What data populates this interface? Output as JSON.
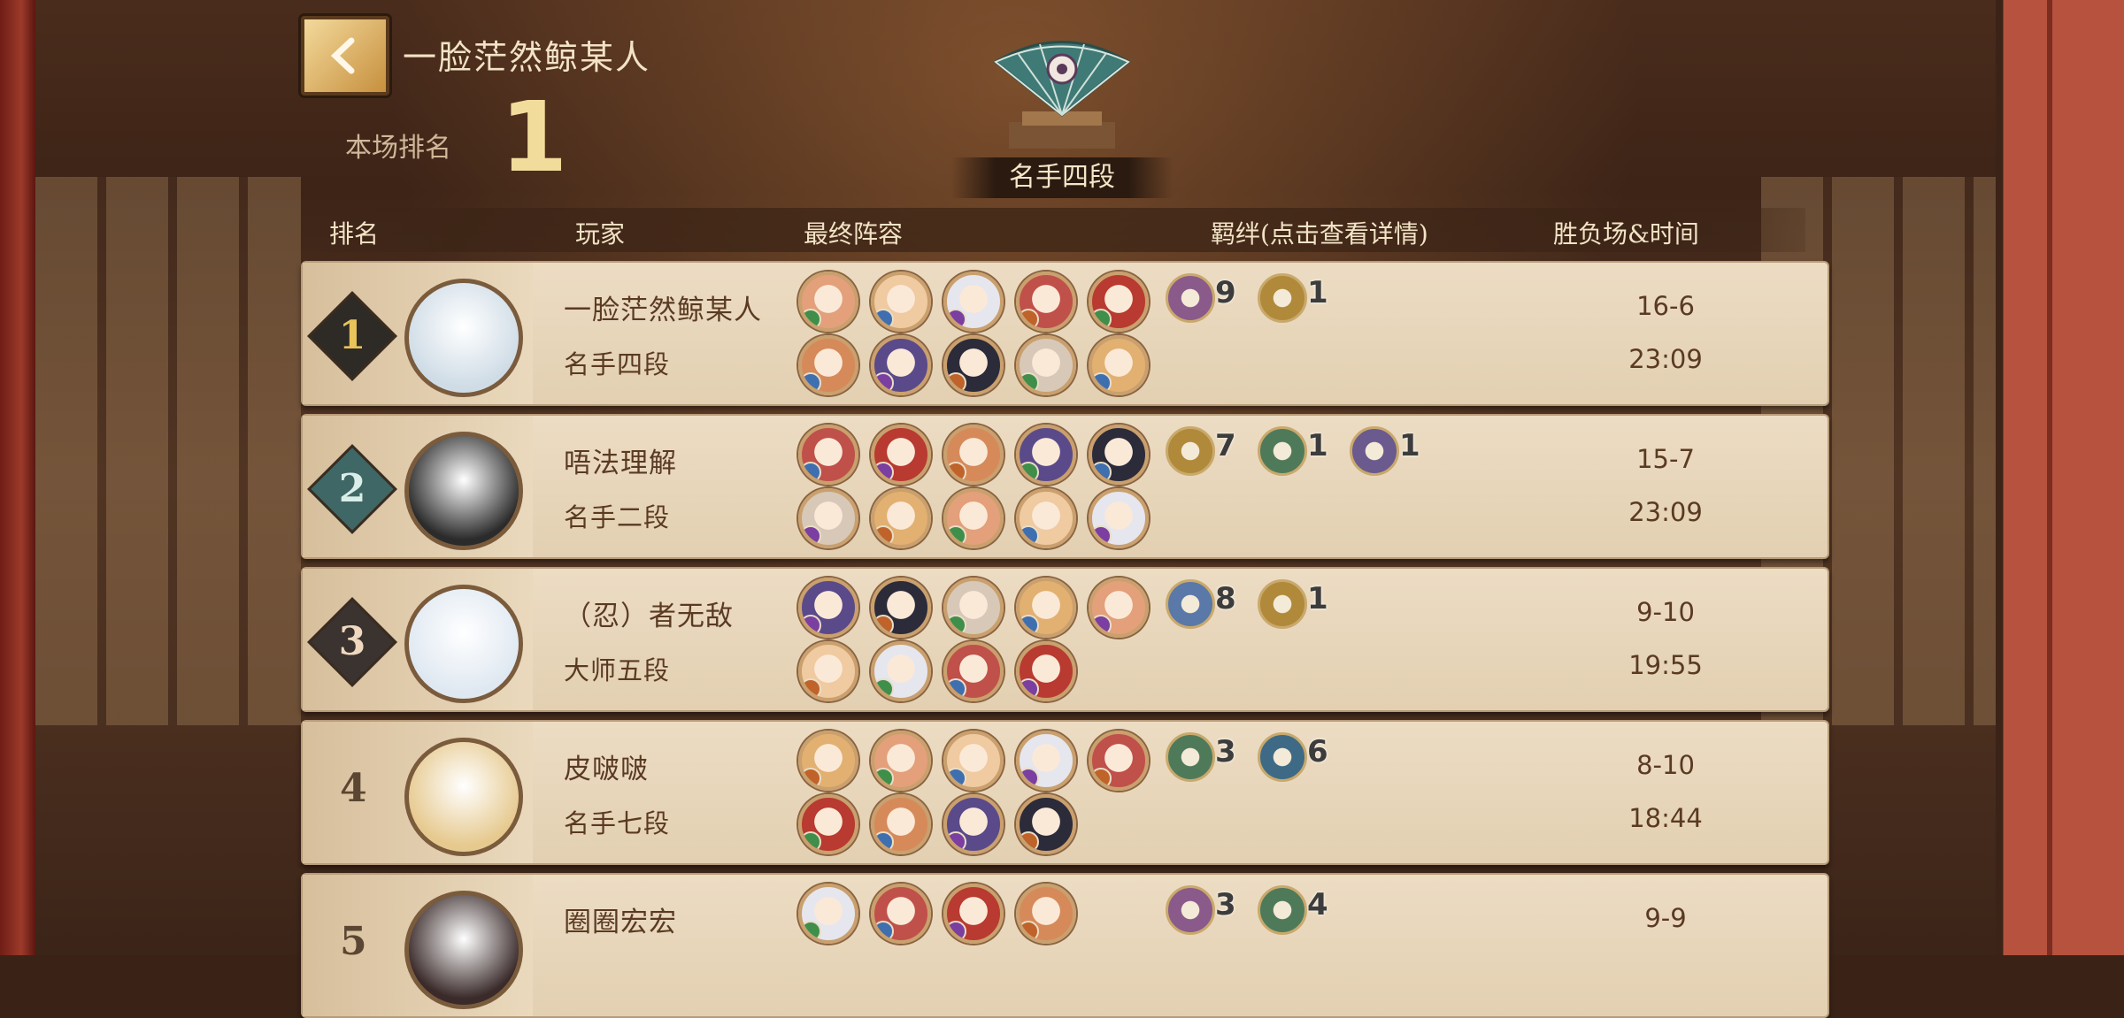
{
  "header": {
    "player_name": "一脸茫然鲸某人",
    "rank_label": "本场排名",
    "rank_value": "1",
    "tier": "名手四段"
  },
  "table": {
    "columns": [
      "排名",
      "玩家",
      "最终阵容",
      "羁绊(点击查看详情)",
      "胜负场&时间"
    ],
    "rows": [
      {
        "rank": "1",
        "name": "一脸茫然鲸某人",
        "tier": "名手四段",
        "win_loss": "16-6",
        "time": "23:09",
        "lineup_count": 10,
        "bonds": [
          {
            "icon": "bond-icon-a",
            "count": "9"
          },
          {
            "icon": "bond-icon-b",
            "count": "1"
          }
        ]
      },
      {
        "rank": "2",
        "name": "唔法理解",
        "tier": "名手二段",
        "win_loss": "15-7",
        "time": "23:09",
        "lineup_count": 10,
        "bonds": [
          {
            "icon": "bond-icon-b",
            "count": "7"
          },
          {
            "icon": "bond-icon-c",
            "count": "1"
          },
          {
            "icon": "bond-icon-d",
            "count": "1"
          }
        ]
      },
      {
        "rank": "3",
        "name": "（忍）者无敌",
        "tier": "大师五段",
        "win_loss": "9-10",
        "time": "19:55",
        "lineup_count": 9,
        "bonds": [
          {
            "icon": "bond-icon-e",
            "count": "8"
          },
          {
            "icon": "bond-icon-b",
            "count": "1"
          }
        ]
      },
      {
        "rank": "4",
        "name": "皮啵啵",
        "tier": "名手七段",
        "win_loss": "8-10",
        "time": "18:44",
        "lineup_count": 9,
        "bonds": [
          {
            "icon": "bond-icon-c",
            "count": "3"
          },
          {
            "icon": "bond-icon-f",
            "count": "6"
          }
        ]
      },
      {
        "rank": "5",
        "name": "圈圈宏宏",
        "tier": "",
        "win_loss": "9-9",
        "time": "",
        "lineup_count": 4,
        "bonds": [
          {
            "icon": "bond-icon-a",
            "count": "3"
          },
          {
            "icon": "bond-icon-c",
            "count": "4"
          }
        ]
      }
    ]
  },
  "colors": {
    "bond_a": "#8a5a8a",
    "bond_b": "#b08a3a",
    "bond_c": "#4f7a5a",
    "bond_d": "#6a5a8e",
    "bond_e": "#5a78a8",
    "bond_f": "#3e6a86",
    "hero_mark_green": "#3f8f4a",
    "hero_mark_blue": "#3f6fae",
    "hero_mark_purple": "#7a3fa0",
    "hero_mark_orange": "#c0632a"
  }
}
